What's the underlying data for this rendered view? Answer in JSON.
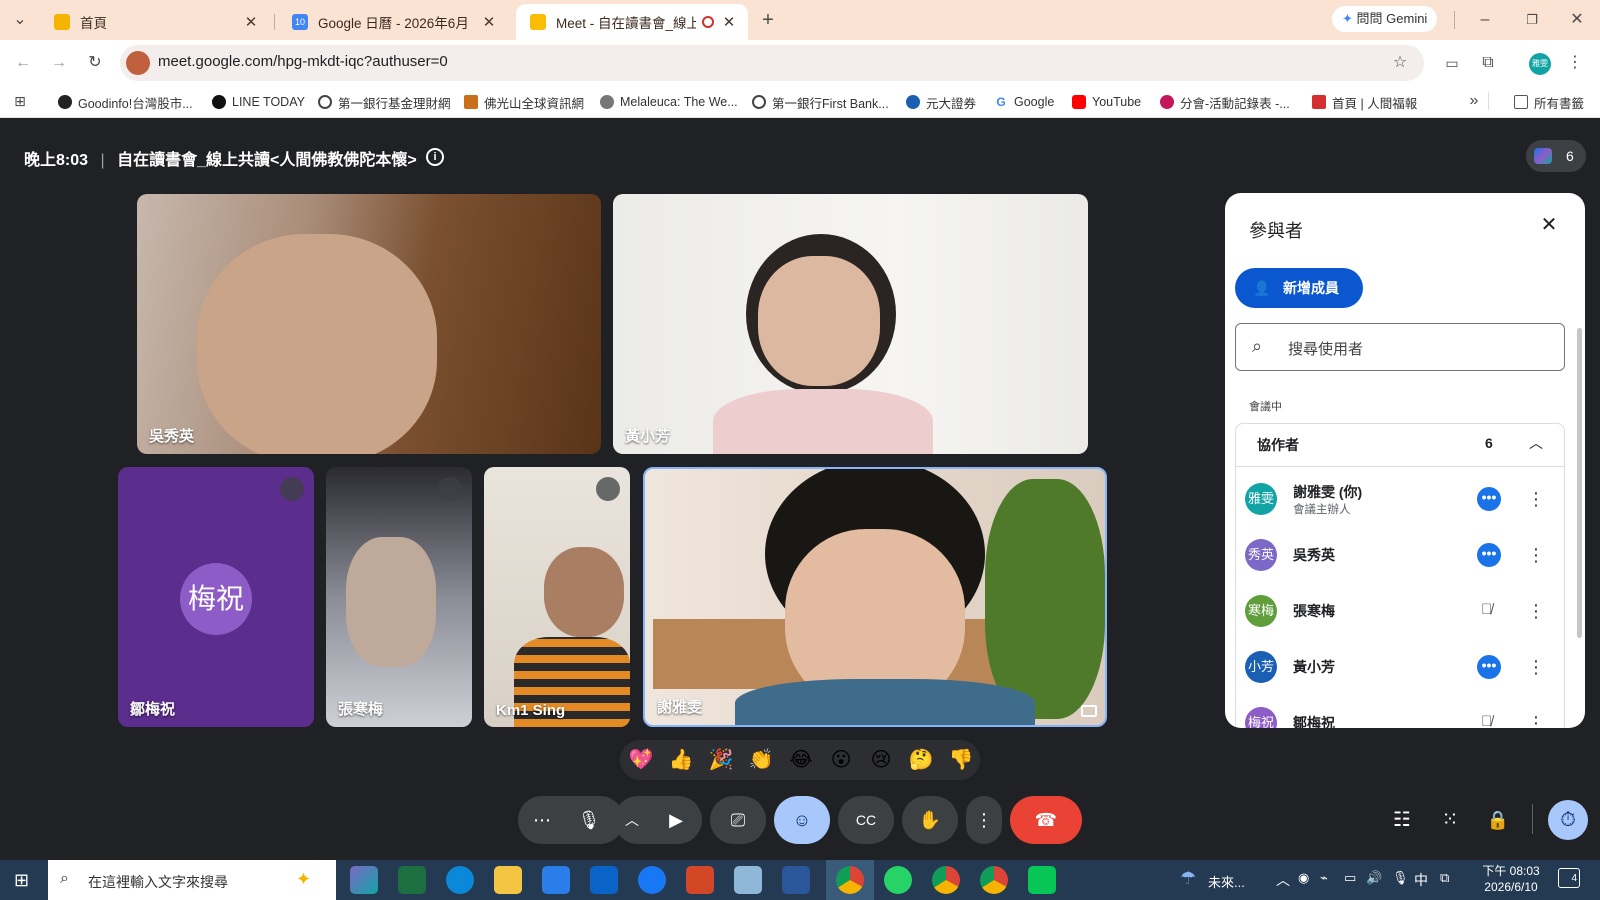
{
  "browser": {
    "tabs": [
      {
        "label": "首頁",
        "icon": "note-icon",
        "color": "#f4b400"
      },
      {
        "label": "Google 日曆 - 2026年6月",
        "icon": "calendar-icon",
        "color": "#4285f4"
      },
      {
        "label": "Meet - 自在讀書會_線上共讀",
        "icon": "meet-icon",
        "color": "#fbbc04"
      }
    ],
    "gemini_label": "問問 Gemini",
    "address": "meet.google.com/hpg-mkdt-iqc?authuser=0",
    "profile_initials": "雅雯",
    "bookmarks": [
      "Goodinfo!台灣股市...",
      "LINE TODAY",
      "第一銀行基金理財網",
      "佛光山全球資訊網",
      "Melaleuca: The We...",
      "第一銀行First Bank...",
      "元大證券",
      "Google",
      "YouTube",
      "分會-活動記錄表 -...",
      "首頁 | 人間福報"
    ],
    "all_bookmarks_label": "所有書籤"
  },
  "meet": {
    "time": "晚上8:03",
    "title": "自在讀書會_線上共讀<人間佛教佛陀本懷>",
    "participant_count": "6",
    "tiles": [
      {
        "name": "吳秀英"
      },
      {
        "name": "黃小芳"
      },
      {
        "name": "鄒梅祝",
        "avatar_text": "梅祝"
      },
      {
        "name": "張寒梅"
      },
      {
        "name": "Km1 Sing"
      },
      {
        "name": "謝雅雯"
      }
    ],
    "reactions": [
      "💖",
      "👍",
      "🎉",
      "👏",
      "😂",
      "😮",
      "😢",
      "🤔",
      "👎"
    ],
    "panel": {
      "title": "參與者",
      "add_button": "新增成員",
      "search_placeholder": "搜尋使用者",
      "section_label": "會議中",
      "group_label": "協作者",
      "group_count": "6",
      "people": [
        {
          "initials": "雅雯",
          "name": "謝雅雯 (你)",
          "sub": "會議主辦人",
          "color": "#12a4a4",
          "state": "speaking"
        },
        {
          "initials": "秀英",
          "name": "吳秀英",
          "sub": "",
          "color": "#7b68c7",
          "state": "speaking"
        },
        {
          "initials": "寒梅",
          "name": "張寒梅",
          "sub": "",
          "color": "#5f9e3b",
          "state": "muted"
        },
        {
          "initials": "小芳",
          "name": "黃小芳",
          "sub": "",
          "color": "#1a5fb4",
          "state": "speaking"
        },
        {
          "initials": "梅祝",
          "name": "鄒梅祝",
          "sub": "",
          "color": "#8e5cc7",
          "state": "muted"
        }
      ]
    }
  },
  "taskbar": {
    "search_placeholder": "在這裡輸入文字來搜尋",
    "weather": "未來...",
    "ime": "中",
    "clock_time": "下午 08:03",
    "clock_date": "2026/6/10",
    "notification_count": "4"
  },
  "colors": {
    "meet_bg": "#202124",
    "end_call": "#ea4335",
    "accent_blue": "#1a73e8",
    "tabbar": "#fbe3d4"
  }
}
